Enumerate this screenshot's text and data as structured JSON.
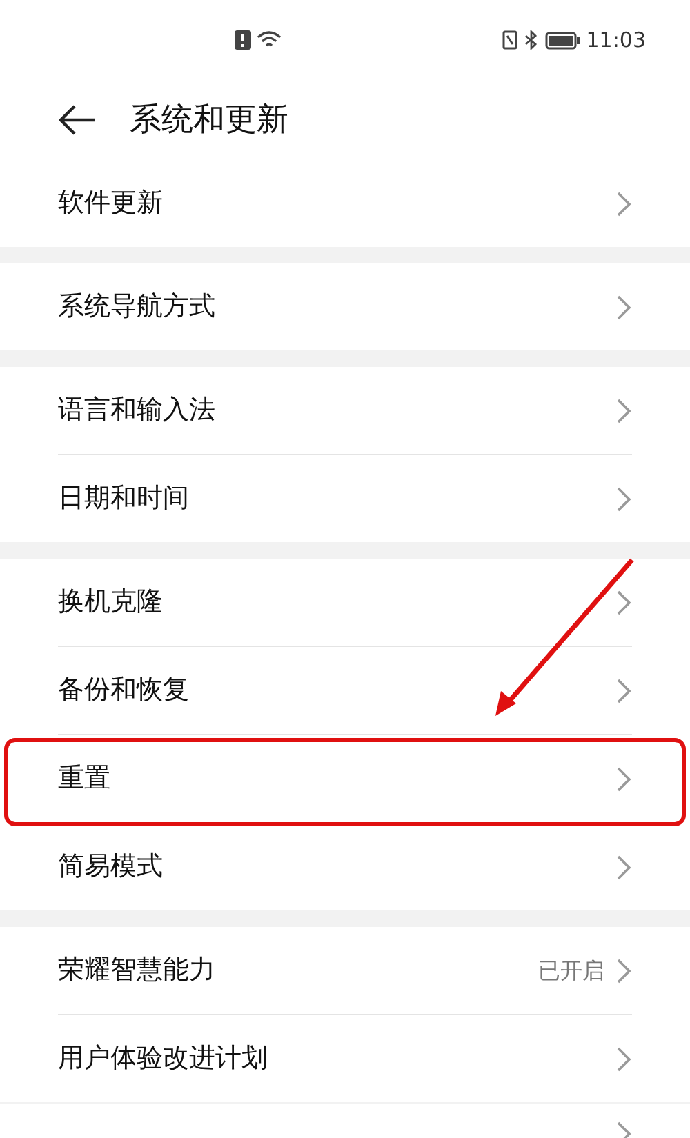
{
  "status_bar": {
    "time": "11:03"
  },
  "header": {
    "title": "系统和更新"
  },
  "groups": [
    {
      "items": [
        {
          "label": "软件更新",
          "highlighted": false
        }
      ]
    },
    {
      "items": [
        {
          "label": "系统导航方式",
          "highlighted": false
        }
      ]
    },
    {
      "items": [
        {
          "label": "语言和输入法",
          "highlighted": false
        },
        {
          "label": "日期和时间",
          "highlighted": false
        }
      ]
    },
    {
      "items": [
        {
          "label": "换机克隆",
          "highlighted": false
        },
        {
          "label": "备份和恢复",
          "highlighted": false
        },
        {
          "label": "重置",
          "highlighted": true
        },
        {
          "label": "简易模式",
          "highlighted": false
        }
      ]
    },
    {
      "items": [
        {
          "label": "荣耀智慧能力",
          "value": "已开启",
          "highlighted": false
        },
        {
          "label": "用户体验改进计划",
          "highlighted": false
        }
      ]
    }
  ]
}
